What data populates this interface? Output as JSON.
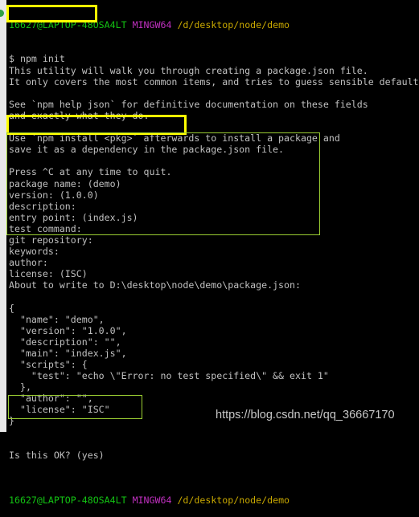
{
  "prompt_top": {
    "user": "16627@LAPTOP-48OSA4LT",
    "system": "MINGW64",
    "path": "/d/desktop/node/demo"
  },
  "lines": [
    "$ npm init",
    "This utility will walk you through creating a package.json file.",
    "It only covers the most common items, and tries to guess sensible defaults.",
    "",
    "See `npm help json` for definitive documentation on these fields",
    "and exactly what they do.",
    "",
    "Use `npm install <pkg>` afterwards to install a package and",
    "save it as a dependency in the package.json file.",
    "",
    "Press ^C at any time to quit.",
    "package name: (demo)",
    "version: (1.0.0)",
    "description:",
    "entry point: (index.js)",
    "test command:",
    "git repository:",
    "keywords:",
    "author:",
    "license: (ISC)",
    "About to write to D:\\desktop\\node\\demo\\package.json:",
    "",
    "{",
    "  \"name\": \"demo\",",
    "  \"version\": \"1.0.0\",",
    "  \"description\": \"\",",
    "  \"main\": \"index.js\",",
    "  \"scripts\": {",
    "    \"test\": \"echo \\\"Error: no test specified\\\" && exit 1\"",
    "  },",
    "  \"author\": \"\",",
    "  \"license\": \"ISC\"",
    "}",
    "",
    "",
    "Is this OK? (yes)",
    ""
  ],
  "prompt_bottom": {
    "user": "16627@LAPTOP-48OSA4LT",
    "system": "MINGW64",
    "path": "/d/desktop/node/demo"
  },
  "watermark": "https://blog.csdn.net/qq_36667170",
  "colors": {
    "highlight_yellow": "#ffff00",
    "highlight_green": "#9acd32",
    "background": "#000000"
  }
}
